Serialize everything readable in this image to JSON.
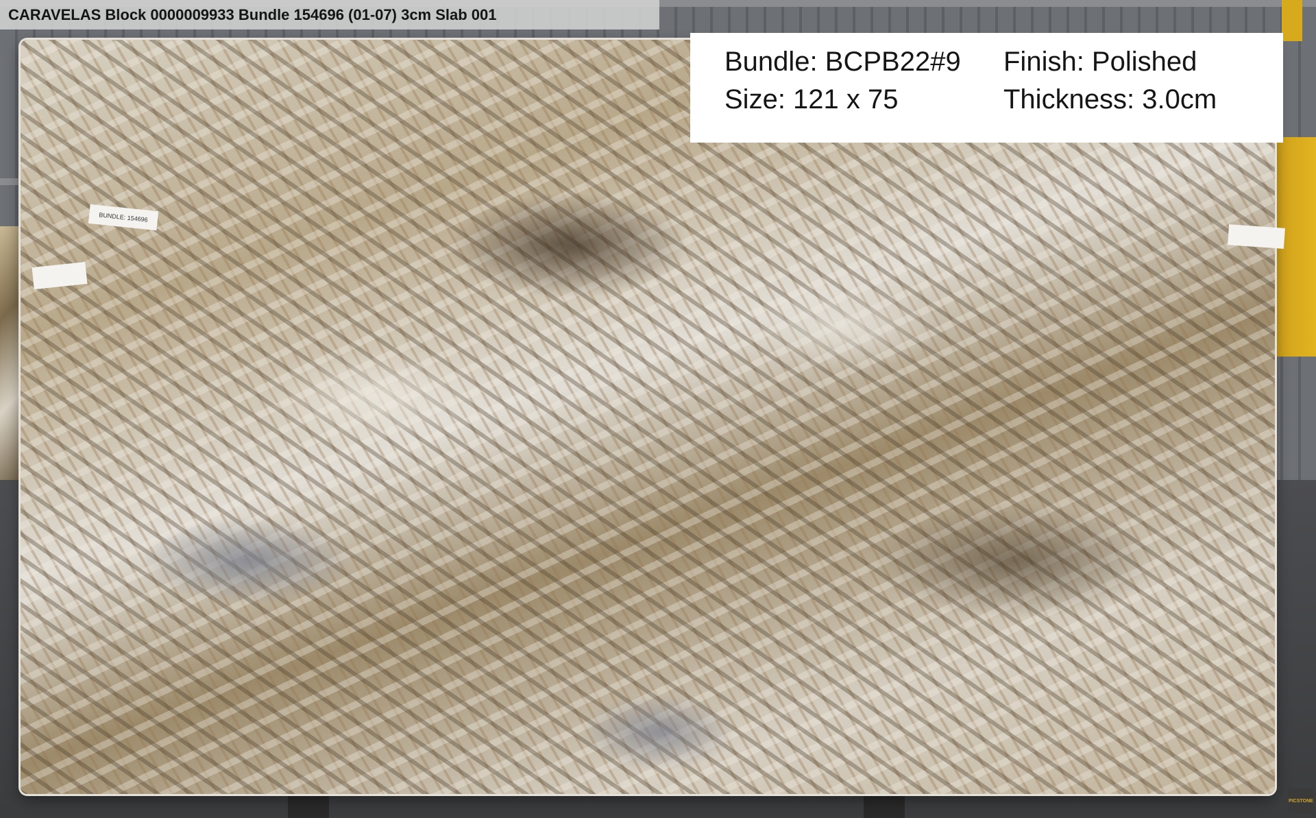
{
  "title_bar": {
    "text": "CARAVELAS Block 0000009933 Bundle 154696 (01-07) 3cm Slab 001"
  },
  "info_box": {
    "bundle": "Bundle: BCPB22#9",
    "finish": "Finish: Polished",
    "size": "Size: 121 x 75",
    "thickness": "Thickness: 3.0cm"
  },
  "slab_tag": {
    "text": "BUNDLE: 154696"
  },
  "watermark": {
    "text": "PICSTONE"
  }
}
